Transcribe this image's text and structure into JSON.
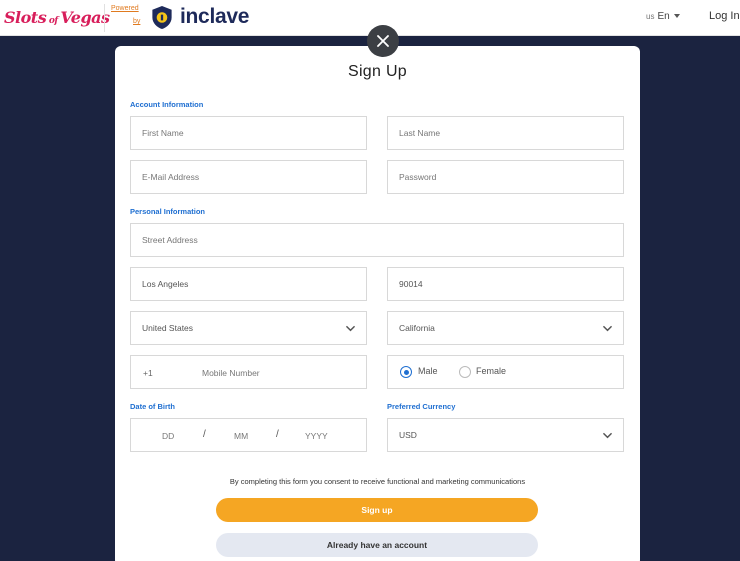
{
  "header": {
    "brand_logo": "Slots of Vegas",
    "powered": "Powered",
    "by": "by",
    "partner_logo": "inclave",
    "lang_region": "us",
    "lang_code": "En",
    "login_label": "Log In"
  },
  "modal": {
    "title": "Sign Up",
    "account_section": "Account Information",
    "personal_section": "Personal Information",
    "dob_section": "Date of Birth",
    "currency_section": "Preferred Currency",
    "first_name_placeholder": "First Name",
    "last_name_placeholder": "Last Name",
    "email_placeholder": "E-Mail Address",
    "password_placeholder": "Password",
    "street_placeholder": "Street Address",
    "city_value": "Los Angeles",
    "zip_value": "90014",
    "country_value": "United States",
    "state_value": "California",
    "phone_code": "+1",
    "phone_placeholder": "Mobile Number",
    "gender_options": [
      "Male",
      "Female"
    ],
    "gender_selected": "Male",
    "dob_day": "DD",
    "dob_month": "MM",
    "dob_year": "YYYY",
    "dob_separator": "/",
    "currency_value": "USD",
    "consent_text": "By completing this form you consent to receive functional and marketing communications",
    "signup_button": "Sign up",
    "existing_account_button": "Already have an account"
  },
  "colors": {
    "background": "#1b2340",
    "accent_blue": "#1f6fd1",
    "signup_orange": "#f5a623",
    "brand_pink": "#d81e5b",
    "inclave_navy": "#1e2a5a"
  },
  "icons": [
    "close-icon",
    "chevron-down-icon",
    "shield-icon",
    "caret-down-icon"
  ]
}
